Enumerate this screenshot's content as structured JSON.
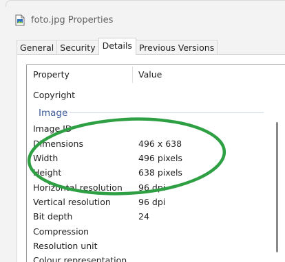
{
  "window": {
    "title": "foto.jpg Properties",
    "file_icon": "image-file-icon"
  },
  "tabs": [
    {
      "label": "General"
    },
    {
      "label": "Security"
    },
    {
      "label": "Details",
      "active": true
    },
    {
      "label": "Previous Versions"
    }
  ],
  "details": {
    "columns": {
      "property": "Property",
      "value": "Value"
    },
    "copyright": {
      "name": "Copyright",
      "value": ""
    },
    "group": "Image",
    "rows": [
      {
        "name": "Image ID",
        "value": ""
      },
      {
        "name": "Dimensions",
        "value": "496 x 638"
      },
      {
        "name": "Width",
        "value": "496 pixels"
      },
      {
        "name": "Height",
        "value": "638 pixels"
      },
      {
        "name": "Horizontal resolution",
        "value": "96 dpi"
      },
      {
        "name": "Vertical resolution",
        "value": "96 dpi"
      },
      {
        "name": "Bit depth",
        "value": "24"
      },
      {
        "name": "Compression",
        "value": ""
      },
      {
        "name": "Resolution unit",
        "value": ""
      },
      {
        "name": "Colour representation",
        "value": ""
      }
    ]
  },
  "annotation": {
    "shape": "ellipse",
    "color": "#2ea043"
  }
}
